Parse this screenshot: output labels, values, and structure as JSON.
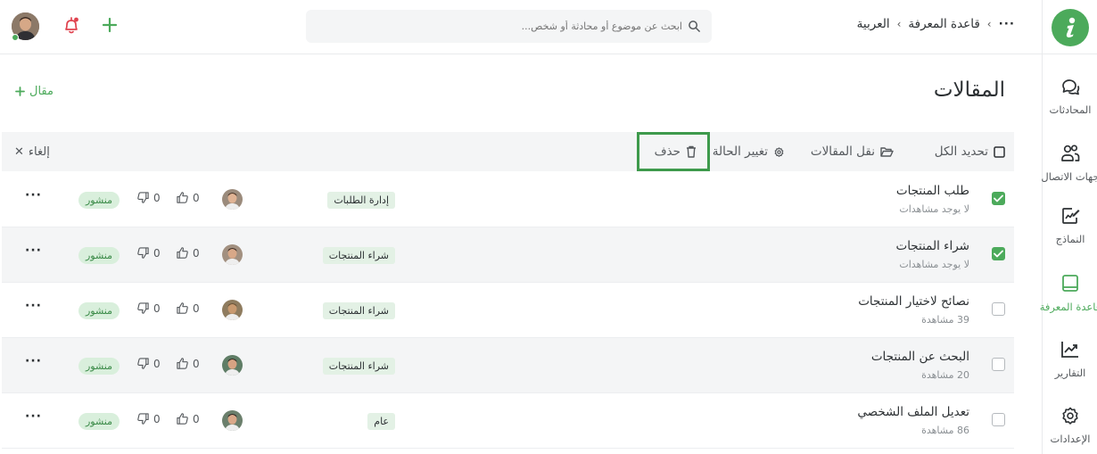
{
  "sidebar": {
    "items": [
      {
        "label": "المحادثات",
        "icon": "chat-bubbles-icon"
      },
      {
        "label": "جهات الاتصال",
        "icon": "contacts-icon"
      },
      {
        "label": "النماذج",
        "icon": "form-edit-icon"
      },
      {
        "label": "قاعدة المعرفة",
        "icon": "book-icon",
        "active": true
      },
      {
        "label": "التقارير",
        "icon": "chart-trend-icon"
      },
      {
        "label": "الإعدادات",
        "icon": "gear-icon"
      }
    ]
  },
  "breadcrumb": {
    "more": "···",
    "items": [
      "قاعدة المعرفة",
      "العربية"
    ]
  },
  "search": {
    "placeholder": "ابحث عن موضوع أو محادثة أو شخص..."
  },
  "page": {
    "title": "المقالات",
    "new_article": "مقال"
  },
  "toolbar": {
    "select_all": "تحديد الكل",
    "move": "نقل المقالات",
    "change_status": "تغيير الحالة",
    "delete": "حذف",
    "cancel": "إلغاء"
  },
  "articles": [
    {
      "title": "طلب المنتجات",
      "views": "لا يوجد مشاهدات",
      "category": "إدارة الطلبات",
      "likes": "0",
      "dislikes": "0",
      "status": "منشور",
      "checked": true
    },
    {
      "title": "شراء المنتجات",
      "views": "لا يوجد مشاهدات",
      "category": "شراء المنتجات",
      "likes": "0",
      "dislikes": "0",
      "status": "منشور",
      "checked": true
    },
    {
      "title": "نصائح لاختيار المنتجات",
      "views": "39 مشاهدة",
      "category": "شراء المنتجات",
      "likes": "0",
      "dislikes": "0",
      "status": "منشور",
      "checked": false
    },
    {
      "title": "البحث عن المنتجات",
      "views": "20 مشاهدة",
      "category": "شراء المنتجات",
      "likes": "0",
      "dislikes": "0",
      "status": "منشور",
      "checked": false
    },
    {
      "title": "تعديل الملف الشخصي",
      "views": "86 مشاهدة",
      "category": "عام",
      "likes": "0",
      "dislikes": "0",
      "status": "منشور",
      "checked": false
    }
  ],
  "colors": {
    "accent": "#4caa5b",
    "highlight_border": "#3e9a4c",
    "notification": "#e0434f"
  }
}
